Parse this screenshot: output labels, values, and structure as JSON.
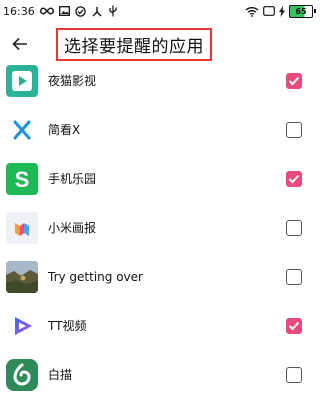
{
  "status": {
    "time": "16:36",
    "battery": "65"
  },
  "header": {
    "title": "选择要提醒的应用"
  },
  "apps": [
    {
      "label": "夜猫影视",
      "icon": "play-video-icon",
      "checked": true
    },
    {
      "label": "简看X",
      "icon": "x-logo-icon",
      "checked": false
    },
    {
      "label": "手机乐园",
      "icon": "s-logo-icon",
      "checked": true
    },
    {
      "label": "小米画报",
      "icon": "xiaomi-wallpaper-icon",
      "checked": false
    },
    {
      "label": "Try getting over",
      "icon": "game-scene-icon",
      "checked": false
    },
    {
      "label": "TT视频",
      "icon": "tt-play-icon",
      "checked": true
    },
    {
      "label": "白描",
      "icon": "baimiao-logo-icon",
      "checked": false
    }
  ],
  "colors": {
    "checked": "#e94c7b",
    "title_border": "#e53935",
    "battery": "#36c25b"
  }
}
